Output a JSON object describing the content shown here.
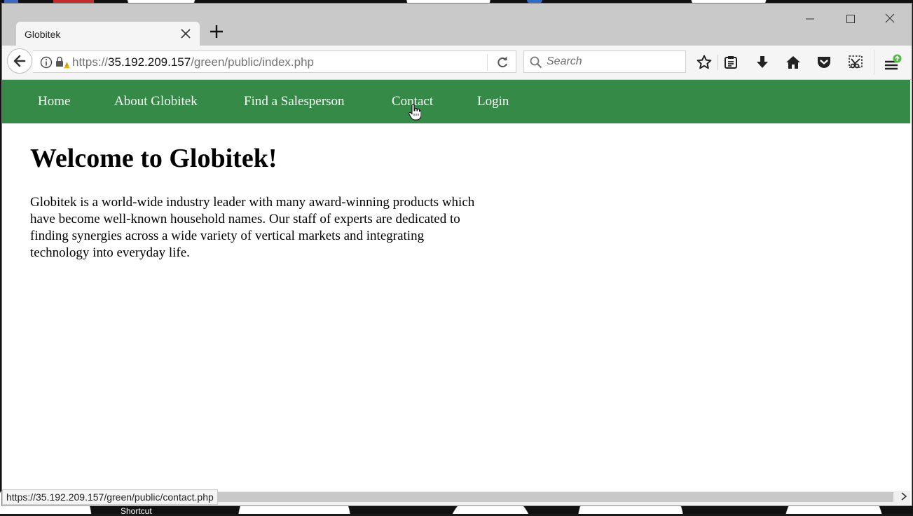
{
  "tab": {
    "title": "Globitek"
  },
  "address": {
    "scheme": "https://",
    "host": "35.192.209.157",
    "path": "/green/public/index.php"
  },
  "search": {
    "placeholder": "Search"
  },
  "site_nav": {
    "items": [
      "Home",
      "About Globitek",
      "Find a Salesperson",
      "Contact",
      "Login"
    ]
  },
  "page": {
    "heading": "Welcome to Globitek!",
    "intro": "Globitek is a world-wide industry leader with many award-winning products which have become well-known household names. Our staff of experts are dedicated to finding synergies across a wide variety of vertical markets and integrating technology into everyday life."
  },
  "status": {
    "link": "https://35.192.209.157/green/public/contact.php"
  },
  "desktop": {
    "shortcut_label": "Shortcut"
  },
  "colors": {
    "site_nav_bg": "#348a46",
    "tab_strip": "#c9c9c9"
  },
  "icons": [
    "back-arrow-icon",
    "info-icon",
    "lock-warning-icon",
    "reload-icon",
    "search-icon",
    "star-icon",
    "reading-list-icon",
    "download-icon",
    "home-icon",
    "pocket-icon",
    "screenshot-icon",
    "menu-icon",
    "update-badge-icon",
    "close-icon",
    "new-tab-icon",
    "minimize-icon",
    "maximize-icon",
    "hand-cursor-icon"
  ]
}
